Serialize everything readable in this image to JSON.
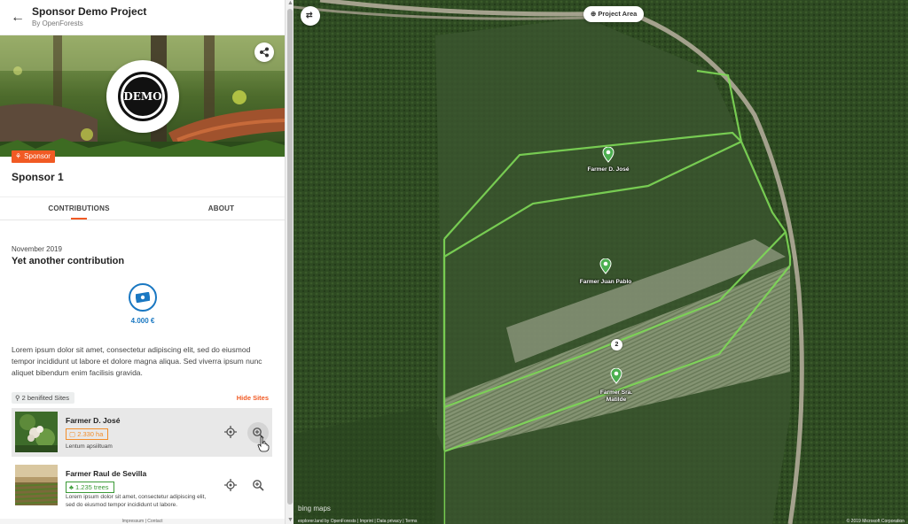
{
  "header": {
    "title": "Sponsor Demo Project",
    "subtitle": "By OpenForests"
  },
  "hero": {
    "logo_text": "DEMO",
    "badge": "Sponsor"
  },
  "sponsor": {
    "name": "Sponsor 1"
  },
  "tabs": [
    {
      "label": "CONTRIBUTIONS",
      "active": true
    },
    {
      "label": "ABOUT",
      "active": false
    }
  ],
  "contribution": {
    "date": "November 2019",
    "title": "Yet another contribution",
    "amount": "4.000 €",
    "description": "Lorem ipsum dolor sit amet, consectetur adipiscing elit, sed do eiusmod tempor incididunt ut labore et dolore magna aliqua. Sed viverra ipsum nunc aliquet bibendum enim facilisis gravida."
  },
  "sites": {
    "count_label": "2 benifited Sites",
    "hide_label": "Hide Sites",
    "items": [
      {
        "name": "Farmer D. José",
        "tag": "2.330 ha",
        "desc": "Lentum apsiiltuam"
      },
      {
        "name": "Farmer Raul de Sevilla",
        "tag": "1.235 trees",
        "desc": "Lorem ipsum dolor sit amet, consectetur adipiscing elit, sed do eiusmod tempor incididunt ut labore."
      }
    ]
  },
  "footer": "Impressum | Contact",
  "map": {
    "project_area_label": "Project Area",
    "markers": [
      {
        "label": "Farmer D. José"
      },
      {
        "label": "Farmer Juan Pablo"
      },
      {
        "label": "Farmer Sra. Matilde"
      }
    ],
    "cluster_count": "2",
    "bing_label": "bing maps",
    "attribution": "explorer.land by OpenForests | Imprint | Data privacy | Terms",
    "copyright": "© 2019 Microsoft Corporation"
  },
  "colors": {
    "accent": "#f15a24",
    "blue": "#1a78c2",
    "polygon": "#7ed957"
  }
}
